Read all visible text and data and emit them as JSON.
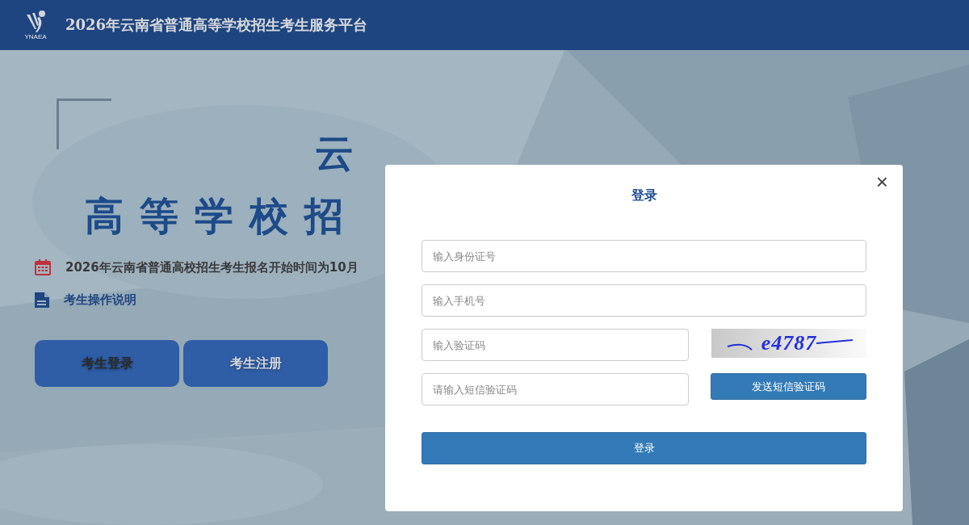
{
  "header": {
    "logo_caption": "YNAEA",
    "title": "2026年云南省普通高等学校招生考生服务平台"
  },
  "hero": {
    "heading_lines": [
      "云",
      "高等学校招"
    ],
    "notice": "2026年云南省普通高校招生考生报名开始时间为10月",
    "guide_link": "考生操作说明",
    "buttons": [
      {
        "label": "考生登录",
        "selected": true
      },
      {
        "label": "考生注册",
        "selected": false
      }
    ]
  },
  "login_dialog": {
    "title": "登录",
    "close": "×",
    "fields": [
      {
        "kind": "wide",
        "placeholder": "输入身份证号"
      },
      {
        "kind": "wide",
        "placeholder": "输入手机号"
      },
      {
        "kind": "captcha",
        "placeholder": "输入验证码",
        "captcha": "e4787"
      },
      {
        "kind": "sms",
        "placeholder": "请输入短信验证码",
        "button": "发送短信验证码"
      }
    ],
    "submit": "登录"
  }
}
